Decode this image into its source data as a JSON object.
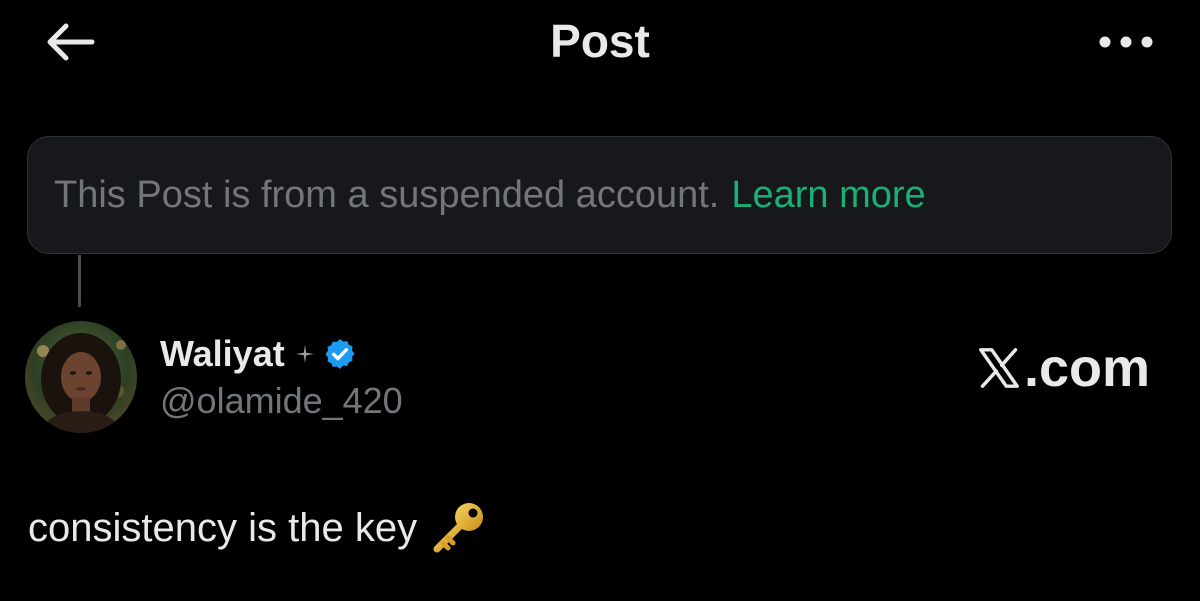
{
  "header": {
    "title": "Post",
    "back_icon": "arrow-left-icon",
    "more_icon": "more-horizontal-icon"
  },
  "notice": {
    "text": "This Post is from a suspended account.",
    "link_label": "Learn more",
    "link_color": "#1aaf74"
  },
  "author": {
    "display_name": "Waliyat",
    "handle": "@olamide_420",
    "verified": true,
    "verified_color": "#1d9bf0",
    "sparkle_icon": "sparkle-icon"
  },
  "watermark": {
    "text": ".com",
    "logo_icon": "x-logo-icon"
  },
  "post": {
    "text": "consistency is the key",
    "emoji_icon": "key-icon"
  },
  "colors": {
    "background": "#000000",
    "primary_text": "#e7e9ea",
    "secondary_text": "#71767b",
    "notice_background": "#16181c"
  }
}
